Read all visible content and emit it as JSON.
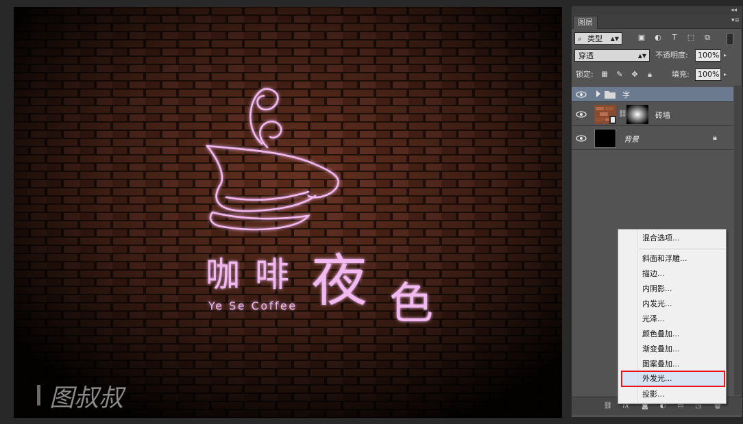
{
  "canvas": {
    "artwork": {
      "chinese_title": [
        "咖",
        "啡",
        "夜",
        "色"
      ],
      "english_title": "Ye Se Coffee",
      "watermark": "图叔叔",
      "neon_color": "#f2b8f0",
      "brick_color": "#6b3422"
    }
  },
  "panel": {
    "tab_label": "图层",
    "filter": {
      "kind_label": "类型"
    },
    "blend_mode": "穿透",
    "opacity_label": "不透明度:",
    "opacity_value": "100%",
    "lock_label": "锁定:",
    "fill_label": "填充:",
    "fill_value": "100%",
    "layers": [
      {
        "name": "字",
        "type": "group",
        "selected": true
      },
      {
        "name": "砖墙",
        "type": "image-with-mask",
        "selected": false
      },
      {
        "name": "背景",
        "type": "background",
        "selected": false
      }
    ],
    "bottom_icons": [
      "link-icon",
      "fx-icon",
      "mask-icon",
      "adjustment-icon",
      "folder-icon",
      "new-layer-icon",
      "trash-icon"
    ]
  },
  "context_menu": {
    "items": [
      {
        "label": "混合选项..."
      },
      {
        "label": "斜面和浮雕..."
      },
      {
        "label": "描边..."
      },
      {
        "label": "内阴影..."
      },
      {
        "label": "内发光..."
      },
      {
        "label": "光泽..."
      },
      {
        "label": "颜色叠加..."
      },
      {
        "label": "渐变叠加..."
      },
      {
        "label": "图案叠加..."
      },
      {
        "label": "外发光..."
      },
      {
        "label": "投影..."
      }
    ],
    "highlighted": "外发光...",
    "highlight_color": "#e8141c"
  }
}
